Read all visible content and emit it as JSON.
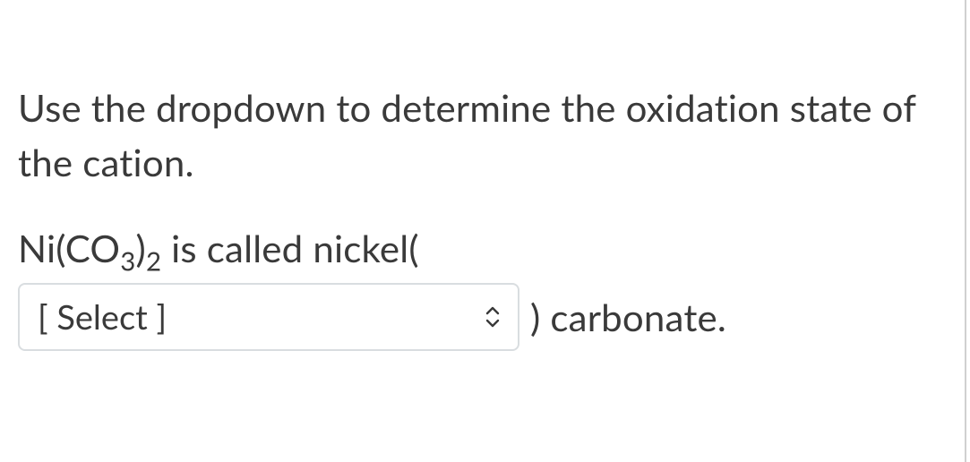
{
  "instruction": "Use the dropdown to determine the oxidation state of the cation.",
  "formula": {
    "prefix": "Ni(CO",
    "sub1": "3",
    "mid": ")",
    "sub2": "2",
    "tail": " is called nickel("
  },
  "select": {
    "placeholder": "[ Select ]"
  },
  "closing": ") carbonate."
}
